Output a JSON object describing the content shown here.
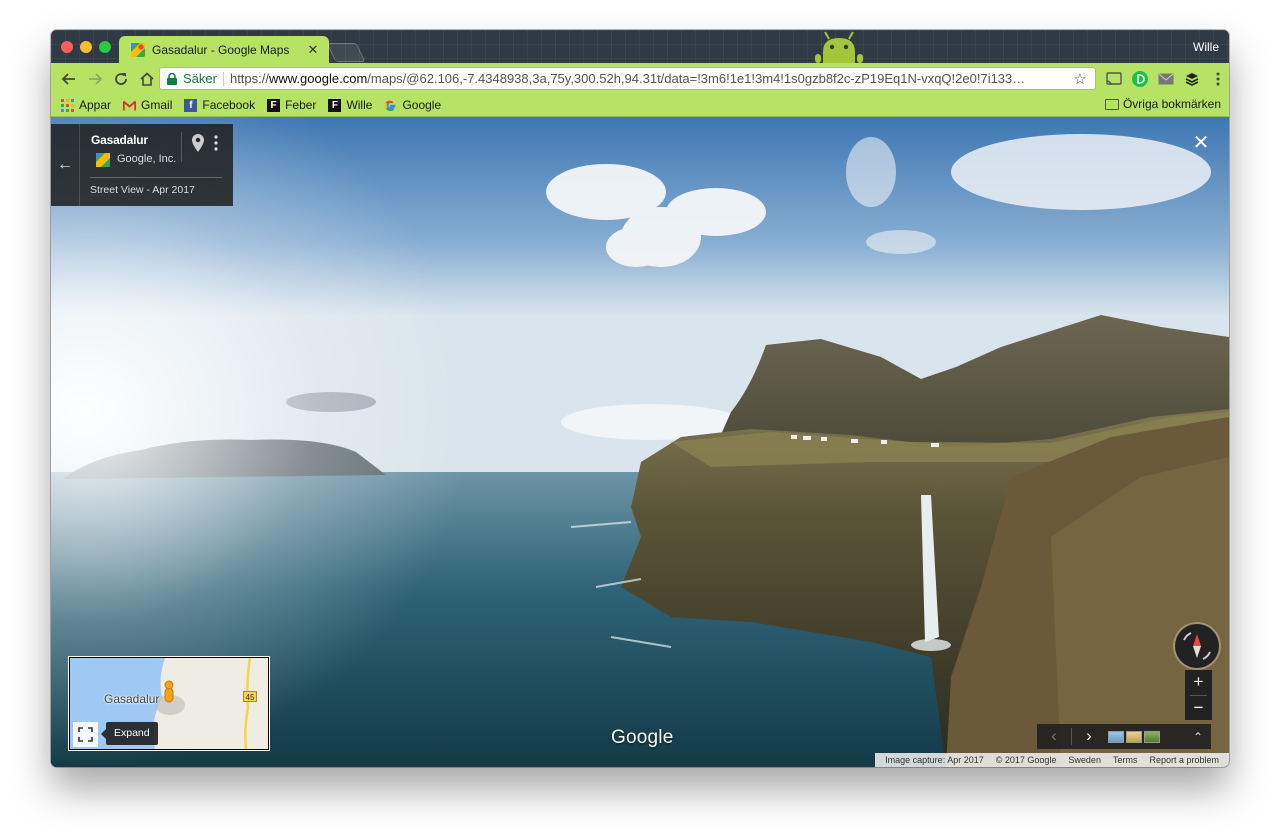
{
  "window": {
    "tab": {
      "title": "Gasadalur - Google Maps",
      "close_glyph": "✕"
    },
    "profile_name": "Wille"
  },
  "toolbar": {
    "secure_label": "Säker",
    "url_scheme": "https://",
    "url_host": "www.google.com",
    "url_path": "/maps/@62.106,-7.4348938,3a,75y,300.52h,94.31t/data=!3m6!1e1!3m4!1s0gzb8f2c-zP19Eq1N-vxqQ!2e0!7i133…",
    "star_glyph": "☆",
    "icons": [
      "back-icon",
      "forward-icon",
      "reload-icon",
      "home-icon",
      "cast-icon",
      "extension-d-icon",
      "mail-icon",
      "buffer-icon",
      "menu-icon"
    ]
  },
  "bookmarks": {
    "items": [
      {
        "label": "Appar",
        "icon": "apps-grid-icon"
      },
      {
        "label": "Gmail",
        "icon": "gmail-icon"
      },
      {
        "label": "Facebook",
        "icon": "facebook-icon"
      },
      {
        "label": "Feber",
        "icon": "feber-icon"
      },
      {
        "label": "Wille",
        "icon": "feber-icon"
      },
      {
        "label": "Google",
        "icon": "google-icon"
      }
    ],
    "other": "Övriga bokmärken"
  },
  "streetview": {
    "place_title": "Gasadalur",
    "owner": "Google, Inc.",
    "capture_date": "Street View - Apr 2017",
    "close_glyph": "✕",
    "minimap": {
      "label": "Gasadalur",
      "road_number": "45",
      "expand_label": "Expand"
    },
    "logo": "Google",
    "zoom_in": "+",
    "zoom_out": "−",
    "prev_glyph": "‹",
    "next_glyph": "›",
    "collapse_glyph": "⌃",
    "footer": {
      "capture": "Image capture: Apr 2017",
      "copyright": "© 2017 Google",
      "country": "Sweden",
      "terms": "Terms",
      "report": "Report a problem"
    }
  },
  "colors": {
    "theme_green": "#b7e365",
    "tabstrip_dark": "#2f3a44",
    "secure_green": "#0b8043"
  }
}
